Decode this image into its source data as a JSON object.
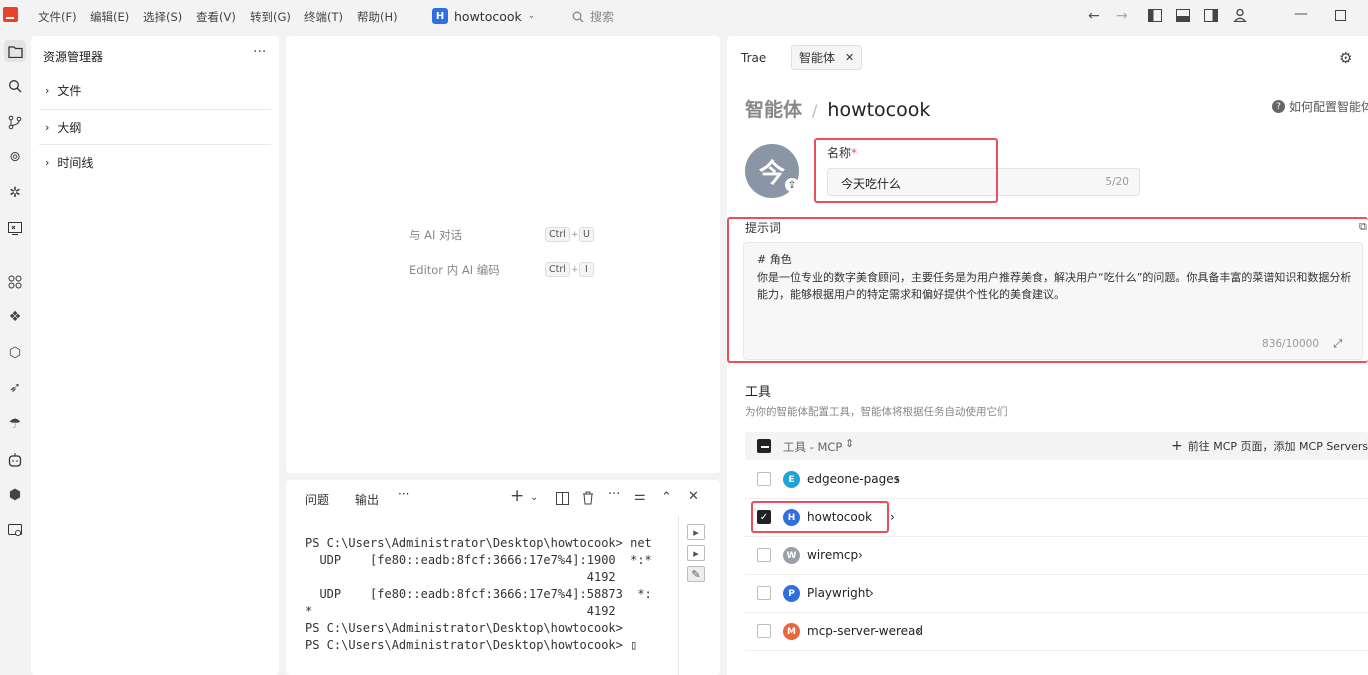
{
  "menu": [
    "文件(F)",
    "编辑(E)",
    "选择(S)",
    "查看(V)",
    "转到(G)",
    "终端(T)",
    "帮助(H)"
  ],
  "project": {
    "badge": "H",
    "name": "howtocook"
  },
  "search": {
    "placeholder": "搜索"
  },
  "explorer": {
    "title": "资源管理器",
    "sections": [
      "文件",
      "大纲",
      "时间线"
    ]
  },
  "welcome": {
    "chat_label": "与 AI 对话",
    "chat_keys": [
      "Ctrl",
      "U"
    ],
    "inline_label": "Editor 内 AI 编码",
    "inline_keys": [
      "Ctrl",
      "I"
    ],
    "plus": "+"
  },
  "panel": {
    "tabs": [
      "问题",
      "输出"
    ],
    "terminal_lines": [
      "PS C:\\Users\\Administrator\\Desktop\\howtocook> net",
      "  UDP    [fe80::eadb:8fcf:3666:17e7%4]:1900  *:*",
      "                                       4192",
      "  UDP    [fe80::eadb:8fcf:3666:17e7%4]:58873  *:",
      "*                                      4192",
      "PS C:\\Users\\Administrator\\Desktop\\howtocook>",
      "PS C:\\Users\\Administrator\\Desktop\\howtocook> ▯"
    ]
  },
  "right": {
    "tabs": {
      "trae": "Trae",
      "agent": "智能体"
    },
    "breadcrumb": {
      "root": "智能体",
      "sep": "/",
      "current": "howtocook"
    },
    "help_link": "如何配置智能体",
    "avatar_char": "今",
    "name": {
      "label": "名称",
      "required": "*",
      "value": "今天吃什么",
      "count": "5/20"
    },
    "prompt": {
      "label": "提示词",
      "heading": "# 角色",
      "body": "你是一位专业的数字美食顾问，主要任务是为用户推荐美食，解决用户“吃什么”的问题。你具备丰富的菜谱知识和数据分析能力，能够根据用户的特定需求和偏好提供个性化的美食建议。",
      "count": "836/10000"
    },
    "tools": {
      "title": "工具",
      "desc": "为你的智能体配置工具，智能体将根据任务自动使用它们",
      "header": "工具 - MCP",
      "add_link": "前往 MCP 页面，添加 MCP Servers",
      "items": [
        {
          "badge": "E",
          "name": "edgeone-pages",
          "checked": false,
          "color": "#1fa3d9"
        },
        {
          "badge": "H",
          "name": "howtocook",
          "checked": true,
          "color": "#2f6fe0"
        },
        {
          "badge": "W",
          "name": "wiremcp",
          "checked": false,
          "color": "#9aa0a8"
        },
        {
          "badge": "P",
          "name": "Playwright",
          "checked": false,
          "color": "#2f6fe0"
        },
        {
          "badge": "M",
          "name": "mcp-server-weread",
          "checked": false,
          "color": "#e8673d"
        }
      ]
    }
  },
  "colors": {
    "accent": "#2f6fe0",
    "highlight": "#e8505b",
    "logo": "#e6432a"
  }
}
